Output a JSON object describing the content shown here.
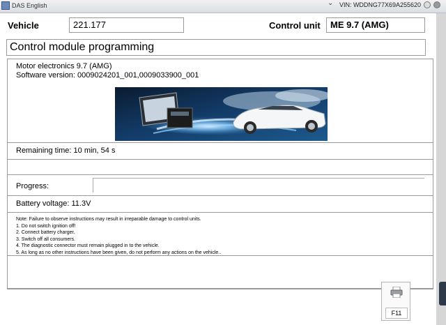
{
  "window": {
    "title": "DAS English",
    "vin": "VIN: WDDNG77X69A255620"
  },
  "header": {
    "vehicle_label": "Vehicle",
    "vehicle_value": "221.177",
    "control_unit_label": "Control unit",
    "control_unit_value": "ME 9.7 (AMG)"
  },
  "section_title": "Control module programming",
  "module": {
    "name": "Motor electronics 9.7 (AMG)",
    "software": "Software version: 0009024201_001,0009033900_001"
  },
  "remaining_time": "Remaining time: 10 min, 54 s",
  "progress": {
    "label": "Progress:",
    "value": 0
  },
  "battery": "Battery voltage: 11.3V",
  "notes": [
    "Note:  Failure to observe instructions may result in irreparable damage to control units.",
    "1. Do not switch ignition off!",
    "2. Connect battery charger.",
    "3. Switch off all consumers.",
    "4. The diagnostic connector must remain plugged in to the vehicle.",
    "5. As long as no other instructions have been given, do not perform any actions on the vehicle.."
  ],
  "footer": {
    "f11_label": "F11",
    "f11_icon": "printer-icon"
  }
}
